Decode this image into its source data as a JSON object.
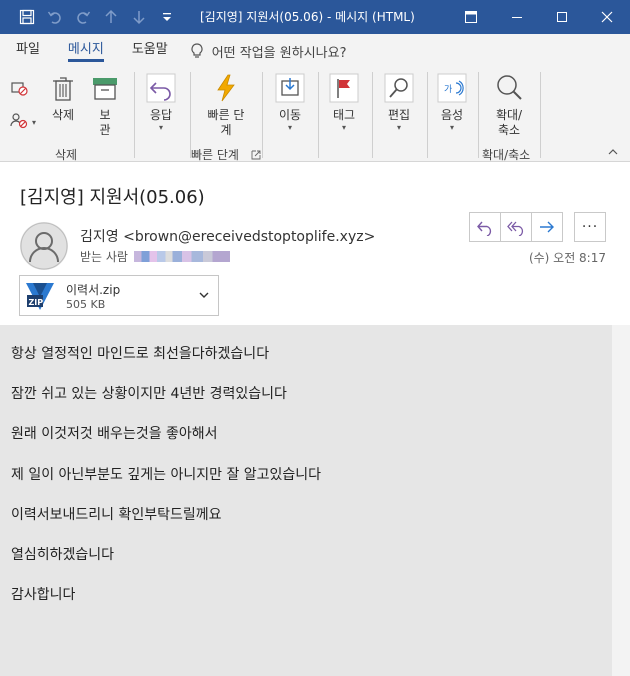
{
  "window": {
    "title": "[김지영] 지원서(05.06)  -  메시지 (HTML)"
  },
  "quick_access": {
    "icons": [
      "save-icon",
      "undo-icon",
      "redo-icon",
      "up-arrow-icon",
      "down-arrow-icon",
      "customize-icon"
    ]
  },
  "tabs": {
    "file": "파일",
    "message": "메시지",
    "help": "도움말",
    "tell_me": "어떤 작업을 원하시나요?"
  },
  "ribbon": {
    "delete": "삭제",
    "archive_1": "보",
    "archive_2": "관",
    "group_delete": "삭제",
    "respond": "응답",
    "quick_steps_1": "빠른 단",
    "quick_steps_2": "계",
    "group_quick_steps": "빠른 단계",
    "move": "이동",
    "tags": "태그",
    "editing": "편집",
    "voice": "음성",
    "zoom_1": "확대/",
    "zoom_2": "축소",
    "group_zoom": "확대/축소"
  },
  "message": {
    "subject": "[김지영] 지원서(05.06)",
    "sender": "김지영 <brown@ereceivedstoptoplife.xyz>",
    "recipient_label": "받는 사람",
    "datetime": "(수) 오전 8:17",
    "more": "···"
  },
  "attachment": {
    "name": "이력서.zip",
    "size": "505 KB"
  },
  "body": {
    "lines": [
      "항상 열정적인 마인드로 최선을다하겠습니다",
      "잠깐 쉬고 있는 상황이지만 4년반 경력있습니다",
      "원래 이것저것 배우는것을 좋아해서",
      "제 일이 아닌부분도 깊게는 아니지만 잘 알고있습니다",
      "이력서보내드리니 확인부탁드릴께요",
      "열심히하겠습니다",
      "감사합니다"
    ]
  },
  "colors": {
    "accent": "#2b579a",
    "action_purple": "#7b5aa6",
    "forward_blue": "#2b79d0",
    "quick_steps_orange": "#f2a900",
    "tag_red": "#d13438"
  }
}
